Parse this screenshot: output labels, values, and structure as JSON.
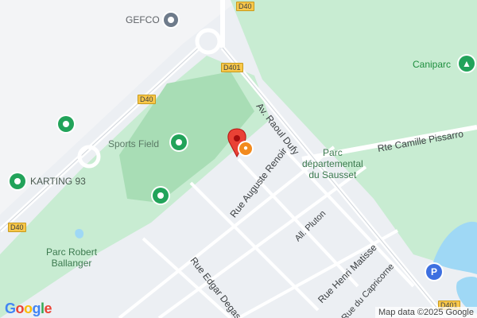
{
  "map": {
    "attribution": "Map data ©2025 Google",
    "logo_text": "Google",
    "shields": [
      "D40",
      "D401",
      "D40",
      "D40",
      "D401"
    ],
    "places": {
      "gefco": "GEFCO",
      "caniparc": "Caniparc",
      "sports_field": "Sports Field",
      "karting": "KARTING 93",
      "parc_departemental": "Parc\ndépartemental\ndu Sausset",
      "parc_robert": "Parc Robert\nBallanger"
    },
    "roads": {
      "av_raoul_dufy": "Av. Raoul Dufy",
      "rue_auguste_renoir": "Rue Auguste Renoir",
      "rte_camille_pissarro": "Rte Camille Pissarro",
      "all_pluton": "All. Pluton",
      "rue_edgar_degas": "Rue Edgar Degas",
      "rue_henri_matisse": "Rue Henri Matisse",
      "rue_du_capricorne": "Rue du Capricorne"
    },
    "colors": {
      "park": "#c8ecd2",
      "field": "#a8ddb5",
      "urban": "#eceff3",
      "pin_red": "#e94235",
      "water": "#9fd8f5"
    }
  }
}
